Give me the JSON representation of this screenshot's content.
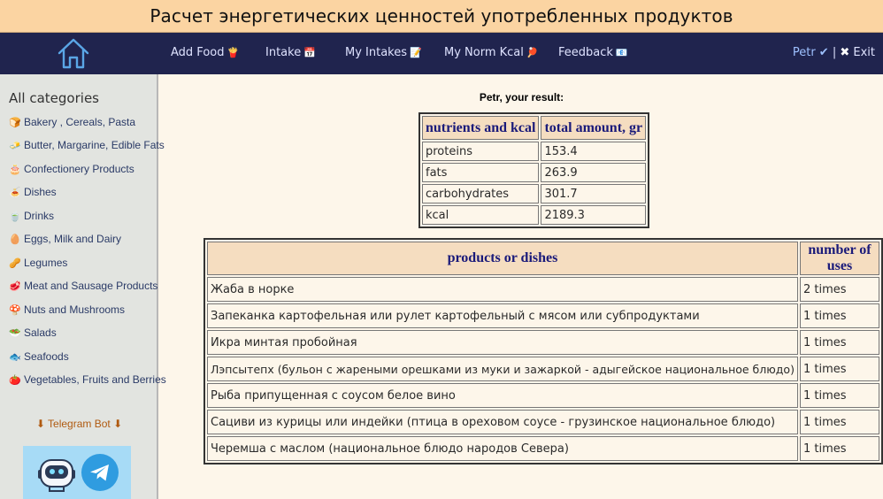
{
  "header": {
    "title": "Расчет энергетических ценностей употребленных продуктов"
  },
  "nav": {
    "home_icon": "house-icon",
    "items": [
      {
        "label": "Add Food",
        "emoji": "🍟"
      },
      {
        "label": "Intake",
        "emoji": "📅"
      },
      {
        "label": "My Intakes",
        "emoji": "📝"
      },
      {
        "label": "My Norm Kcal",
        "emoji": "🏓"
      },
      {
        "label": "Feedback",
        "emoji": "📧"
      }
    ],
    "user": {
      "name": "Petr ✔",
      "separator": " | ",
      "exit_icon": "✖",
      "exit_label": " Exit"
    }
  },
  "sidebar": {
    "heading": "All categories",
    "categories": [
      {
        "icon": "🍞",
        "label": "Bakery , Cereals, Pasta"
      },
      {
        "icon": "🧈",
        "label": "Butter, Margarine, Edible Fats"
      },
      {
        "icon": "🎂",
        "label": "Confectionery Products"
      },
      {
        "icon": "🍝",
        "label": "Dishes"
      },
      {
        "icon": "🍵",
        "label": "Drinks"
      },
      {
        "icon": "🥚",
        "label": "Eggs, Milk and Dairy"
      },
      {
        "icon": "🥜",
        "label": "Legumes"
      },
      {
        "icon": "🥩",
        "label": "Meat and Sausage Products"
      },
      {
        "icon": "🍄",
        "label": "Nuts and Mushrooms"
      },
      {
        "icon": "🥗",
        "label": "Salads"
      },
      {
        "icon": "🐟",
        "label": "Seafoods"
      },
      {
        "icon": "🍅",
        "label": "Vegetables, Fruits and Berries"
      }
    ],
    "telegram_link": "⬇ Telegram Bot ⬇",
    "colors": {
      "telegram_blue": "#2f9ce0",
      "telegram_bg": "#a7dbf6"
    }
  },
  "main": {
    "result_title": "Petr, your result:",
    "nutrients_table": {
      "headers": [
        "nutrients and kcal",
        "total amount, gr"
      ],
      "rows": [
        [
          "proteins",
          "153.4"
        ],
        [
          "fats",
          "263.9"
        ],
        [
          "carbohydrates",
          "301.7"
        ],
        [
          "kcal",
          "2189.3"
        ]
      ]
    },
    "products_table": {
      "headers": [
        "products or dishes",
        "number of uses"
      ],
      "rows": [
        [
          "Жаба в норке",
          "2 times"
        ],
        [
          "Запеканка картофельная или рулет картофельный с мясом или субпродуктами",
          "1 times"
        ],
        [
          "Икра минтая пробойная",
          "1 times"
        ],
        [
          "Лэпсытепх (бульон с жареными орешками из муки и зажаркой - адыгейское национальное блюдо)",
          "1 times"
        ],
        [
          "Рыба припущенная с соусом белое вино",
          "1 times"
        ],
        [
          "Сациви из курицы или индейки (птица в ореховом соусе - грузинское национальное блюдо)",
          "1 times"
        ],
        [
          "Черемша с маслом (национальное блюдо народов Севера)",
          "1 times"
        ]
      ]
    }
  }
}
